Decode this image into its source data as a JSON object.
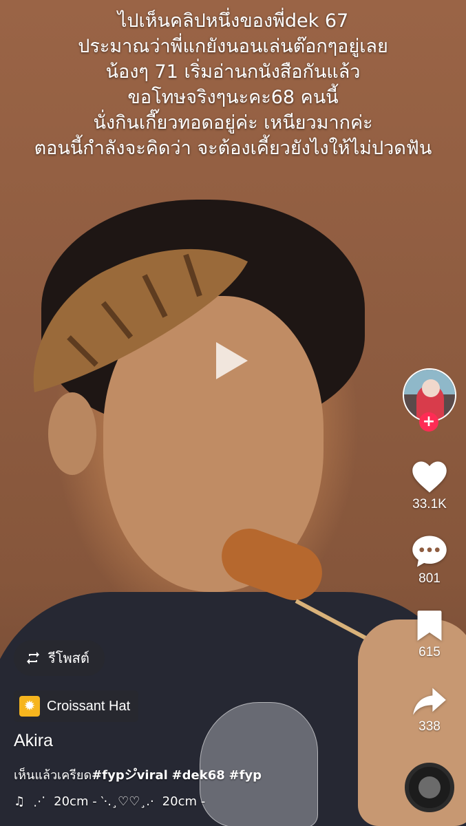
{
  "video": {
    "caption_lines": [
      "ไปเห็นคลิปหนึ่งของพี่dek 67",
      "ประมาณว่าพี่แกยังนอนเล่นต๊อกๆอยู่เลย",
      "น้องๆ 71 เริ่มอ่านกนังสือกันแล้ว",
      "ขอโทษจริงๆนะคะ68 คนนี้",
      "นั่งกินเกี๊ยวทอดอยู่ค่ะ เหนียวมากค่ะ",
      "ตอนนี้กำลังจะคิดว่า จะต้องเคี้ยวยังไงให้ไม่ปวดฟัน"
    ],
    "play_icon": "play-icon"
  },
  "rail": {
    "avatar_icon": "profile-avatar",
    "follow_symbol": "+",
    "likes": "33.1K",
    "comments": "801",
    "saves": "615",
    "shares": "338",
    "accent": "#fe2c55"
  },
  "overlay": {
    "repost_label": "รีโพสต์",
    "effect_label": "Croissant Hat",
    "username": "Akira",
    "description": {
      "text": "เห็นแล้วเครียด",
      "tags": [
        "#fypシ゚viral",
        "#dek68",
        "#fyp"
      ],
      "first_tag": "#fypシ゚viral",
      "second_tag": "#dek68",
      "third_tag": "#fyp"
    },
    "music": {
      "icon": "music-note-icon",
      "part1": "⋰",
      "part2": "20cm - ‵·.¸♡♡¸.·",
      "part3": "20cm -"
    }
  }
}
